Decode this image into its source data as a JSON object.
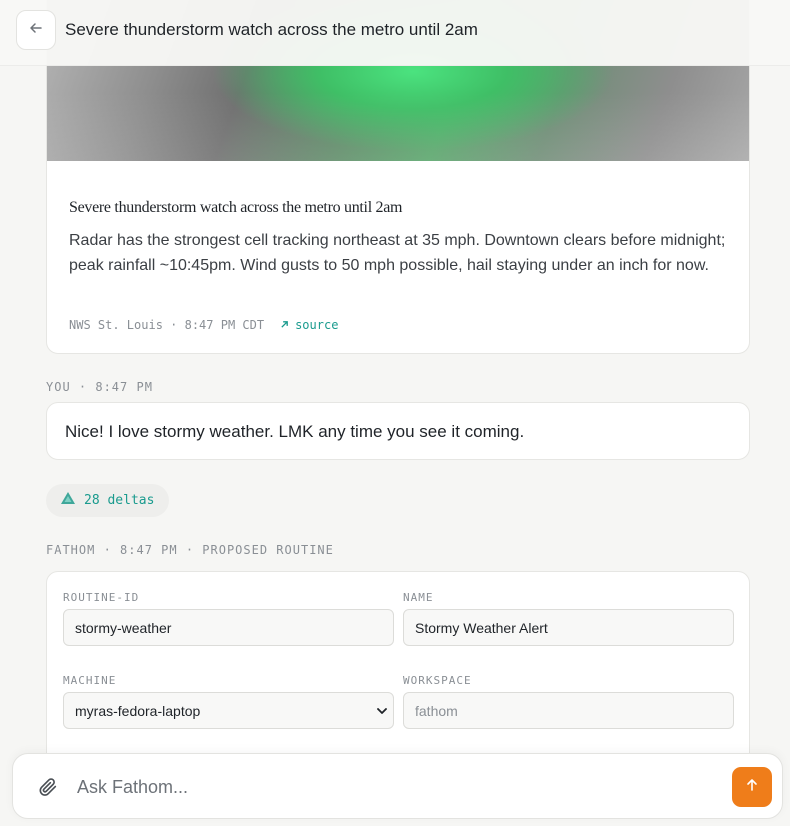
{
  "header": {
    "title": "Severe thunderstorm watch across the metro until 2am",
    "back_icon": "arrow-left-icon"
  },
  "alert_card": {
    "headline": "Severe thunderstorm watch across the metro until 2am",
    "body": "Radar has the strongest cell tracking northeast at 35 mph. Downtown clears before midnight; peak rainfall ~10:45pm. Wind gusts to 50 mph possible, hail staying under an inch for now.",
    "meta": "NWS St. Louis · 8:47 PM CDT",
    "source_label": "source",
    "source_icon": "arrow-up-right-icon"
  },
  "user_message": {
    "label": "YOU · 8:47 PM",
    "text": "Nice! I love stormy weather. LMK any time you see it coming."
  },
  "deltas": {
    "label": "28 deltas",
    "icon": "delta-icon"
  },
  "proposal": {
    "label": "FATHOM · 8:47 PM · PROPOSED ROUTINE",
    "routine_id_label": "ROUTINE-ID",
    "routine_id_value": "stormy-weather",
    "name_label": "NAME",
    "name_value": "Stormy Weather Alert",
    "machine_label": "MACHINE",
    "machine_value": "myras-fedora-laptop",
    "workspace_label": "WORKSPACE",
    "workspace_placeholder": "fathom"
  },
  "composer": {
    "placeholder": "Ask Fathom...",
    "attach_icon": "paperclip-icon",
    "send_icon": "arrow-up-icon"
  },
  "colors": {
    "accent_teal": "#1a9b8e",
    "send_orange": "#ef7d1a",
    "background": "#f6f6f4"
  }
}
